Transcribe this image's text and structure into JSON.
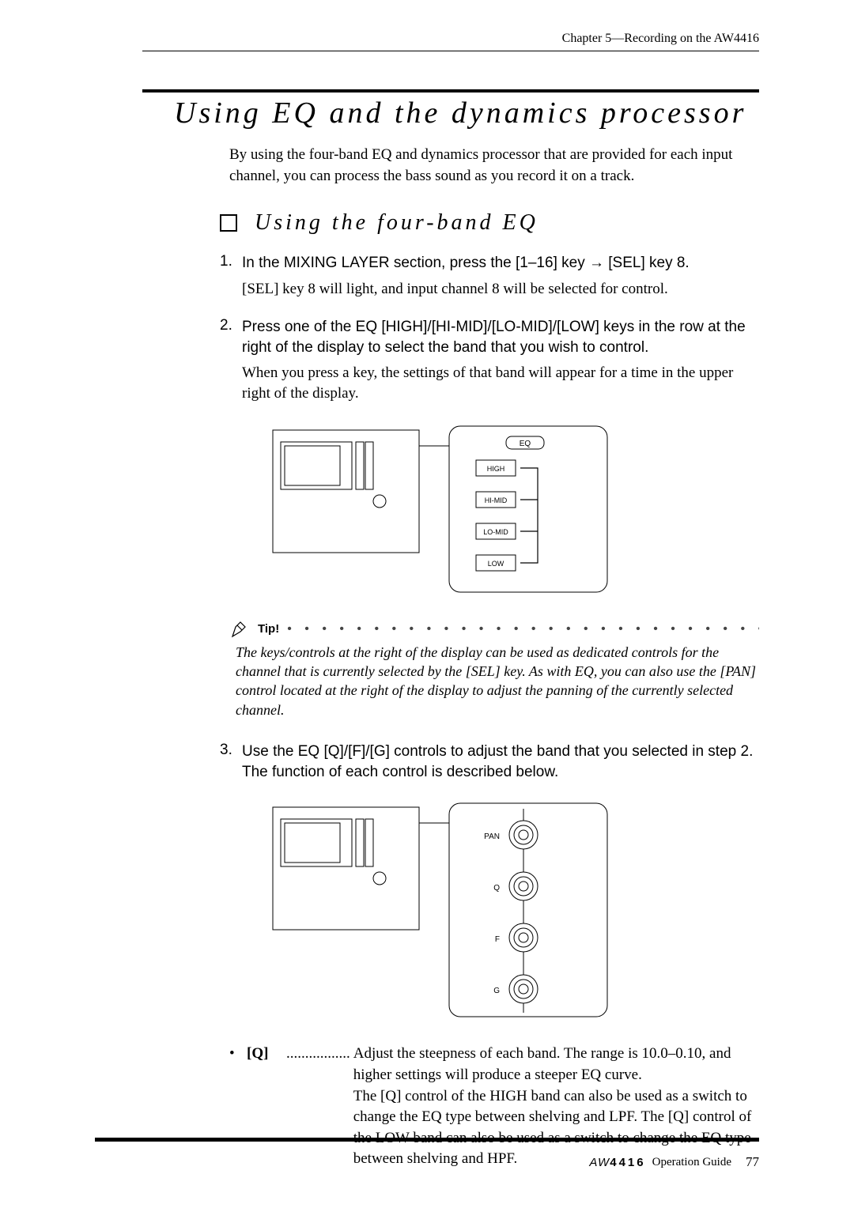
{
  "header": "Chapter 5—Recording on the AW4416",
  "section_title": "Using EQ and the dynamics processor",
  "intro": "By using the four-band EQ and dynamics processor that are provided for each input channel, you can process the bass sound as you record it on a track.",
  "sub_heading": "Using the four-band EQ",
  "steps": {
    "s1": {
      "num": "1.",
      "head_a": "In the MIXING LAYER section, press the [1–16] key ",
      "arrow": "→",
      "head_b": " [SEL] key 8.",
      "detail": "[SEL] key 8 will light, and input channel 8 will be selected for control."
    },
    "s2": {
      "num": "2.",
      "head": "Press one of the EQ [HIGH]/[HI-MID]/[LO-MID]/[LOW] keys in the row at the right of the display to select the band that you wish to control.",
      "detail": "When you press a key, the settings of that band will appear for a time in the upper right of the display."
    },
    "s3": {
      "num": "3.",
      "head": "Use the EQ [Q]/[F]/[G] controls to adjust the band that you selected in step 2. The function of each control is described below."
    }
  },
  "diagram1": {
    "eq": "EQ",
    "high": "HIGH",
    "himid": "HI-MID",
    "lomid": "LO-MID",
    "low": "LOW"
  },
  "diagram2": {
    "pan": "PAN",
    "q": "Q",
    "f": "F",
    "g": "G"
  },
  "tip": {
    "label": "Tip!",
    "dots": "• • • • • • • • • • • • • • • • • • • • • • • • • • • • • • • • • • • • • • • • • • • •",
    "text": "The keys/controls at the right of the display can be used as dedicated controls for the channel that is currently selected by the [SEL] key. As with EQ, you can also use the [PAN] control located at the right of the display to adjust the panning of the currently selected channel."
  },
  "bullet": {
    "mark": "•",
    "label": "[Q]",
    "dots": ".................",
    "body": "Adjust the steepness of each band. The range is 10.0–0.10, and higher settings will produce a steeper EQ curve.\nThe [Q] control of the HIGH band can also be used as a switch to change the EQ type between shelving and LPF. The [Q] control of the LOW band can also be used as a switch to change the EQ type between shelving and HPF."
  },
  "footer": {
    "logo1": "AW",
    "logo2": "4416",
    "guide": "Operation Guide",
    "page": "77"
  }
}
